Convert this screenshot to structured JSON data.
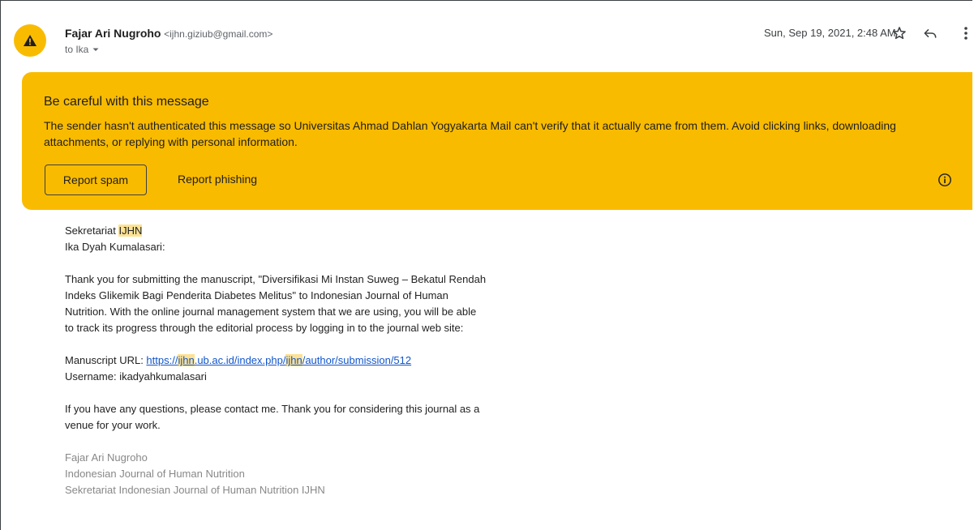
{
  "header": {
    "avatar_icon": "warning-triangle-icon",
    "sender_name": "Fajar Ari Nugroho",
    "sender_email": "<ijhn.giziub@gmail.com>",
    "to_text": "to Ika",
    "date": "Sun, Sep 19, 2021, 2:48 AM",
    "icons": [
      "star-icon",
      "reply-icon",
      "more-vert-icon"
    ]
  },
  "banner": {
    "title": "Be careful with this message",
    "text": "The sender hasn't authenticated this message so Universitas Ahmad Dahlan Yogyakarta Mail can't verify that it actually came from them. Avoid clicking links, downloading attachments, or replying with personal information.",
    "report_spam": "Report spam",
    "report_phishing": "Report phishing",
    "color": "#f9bb00"
  },
  "body": {
    "greet_prefix": "Sekretariat ",
    "greet_hl": "IJHN",
    "addressee": "Ika Dyah Kumalasari:",
    "para1": "Thank you for submitting the manuscript, \"Diversifikasi Mi Instan Suweg – Bekatul Rendah Indeks Glikemik Bagi Penderita Diabetes Melitus\" to Indonesian Journal of Human Nutrition. With the online journal management system that we are using, you will be able to track its progress through the editorial process by logging in to the journal web site:",
    "url_label": "Manuscript URL: ",
    "url_a": "https://",
    "url_hl1": "ijhn",
    "url_b": ".ub.ac.id/index.php/",
    "url_hl2": "ijhn",
    "url_c": "/author/submission/512",
    "username": "Username: ikadyahkumalasari",
    "para2": "If you have any questions, please contact me. Thank you for considering this journal as a venue for your work.",
    "sig_name": "Fajar Ari Nugroho",
    "sig_journal": "Indonesian Journal of Human Nutrition",
    "sig_cut": "Sekretariat Indonesian Journal of Human Nutrition IJHN"
  }
}
